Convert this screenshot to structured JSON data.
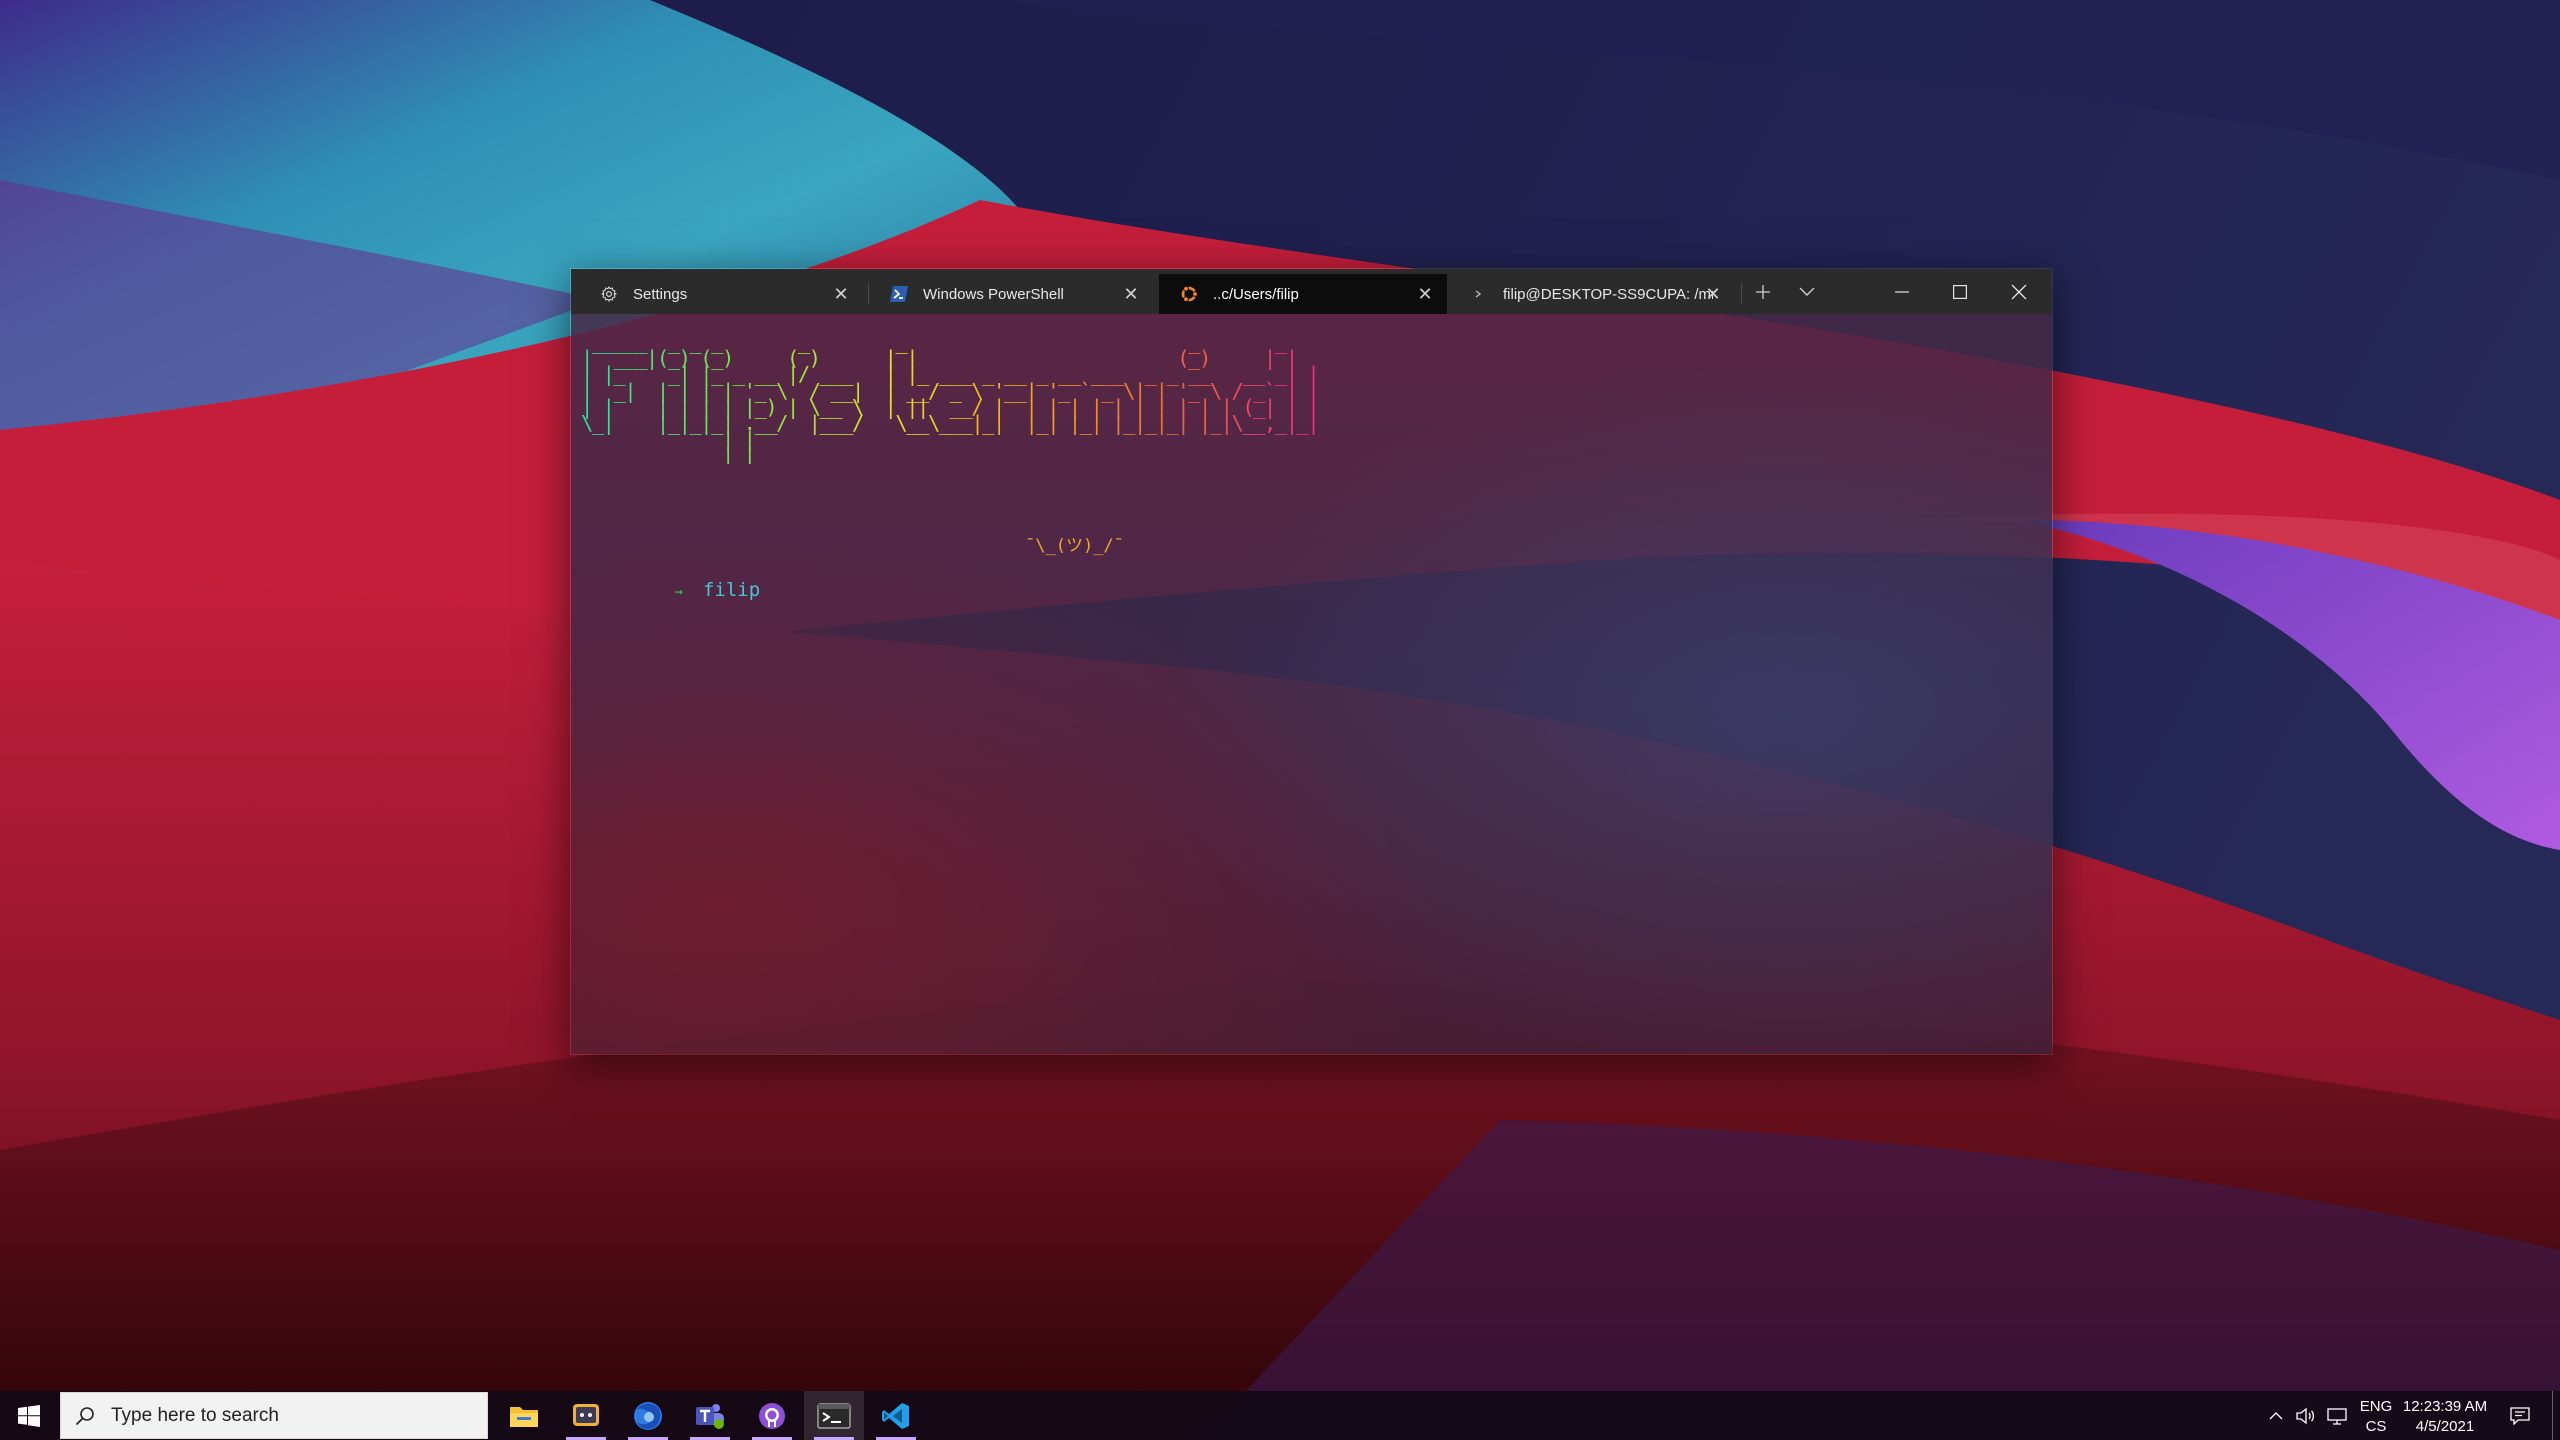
{
  "terminal": {
    "tabs": [
      {
        "label": "Settings",
        "icon": "gear-icon",
        "active": false
      },
      {
        "label": "Windows PowerShell",
        "icon": "powershell-icon",
        "active": false
      },
      {
        "label": "..c/Users/filip",
        "icon": "ubuntu-icon",
        "active": true
      },
      {
        "label": "filip@DESKTOP-SS9CUPA: /mr",
        "icon": "linux-icon",
        "active": false
      }
    ],
    "banner": " _____  _ _ _       _        _                          _       _ \n|  ___|(_) (_)     ( )      | |                        (_)     | |\n| |_    _| |_ _ __ |/ ___   | |_ ___ _ __ _ __ ___  _ _ __   __ _| |\n|  _|  | | | | '_ \\  / __|  | __/ _ \\ '__| '_ ` _ \\| | '_ \\ / _` | |\n| |    | | | | |_) | \\__ \\  | ||  __/ |  | | | | | | | | | | (_| | |\n\\_|    |_|_|_| .__/  |___/   \\__\\___|_|  |_| |_| |_|_|_| |_|\\__,_|_|\n             | |\n             |_|",
    "shrug": "¯\\_(ツ)_/¯",
    "prompt_arrow": "→",
    "prompt_dir": "filip",
    "accent_active_tab": "#0c0c0c"
  },
  "taskbar": {
    "search_placeholder": "Type here to search",
    "apps": [
      {
        "name": "file-explorer-icon",
        "running": false
      },
      {
        "name": "discord-icon",
        "running": true
      },
      {
        "name": "firefox-icon",
        "running": true
      },
      {
        "name": "teams-icon",
        "running": true
      },
      {
        "name": "github-desktop-icon",
        "running": true
      },
      {
        "name": "windows-terminal-icon",
        "running": true
      },
      {
        "name": "vscode-icon",
        "running": true
      }
    ],
    "language_primary": "ENG",
    "language_secondary": "CS",
    "time": "12:23:39 AM",
    "date": "4/5/2021"
  }
}
